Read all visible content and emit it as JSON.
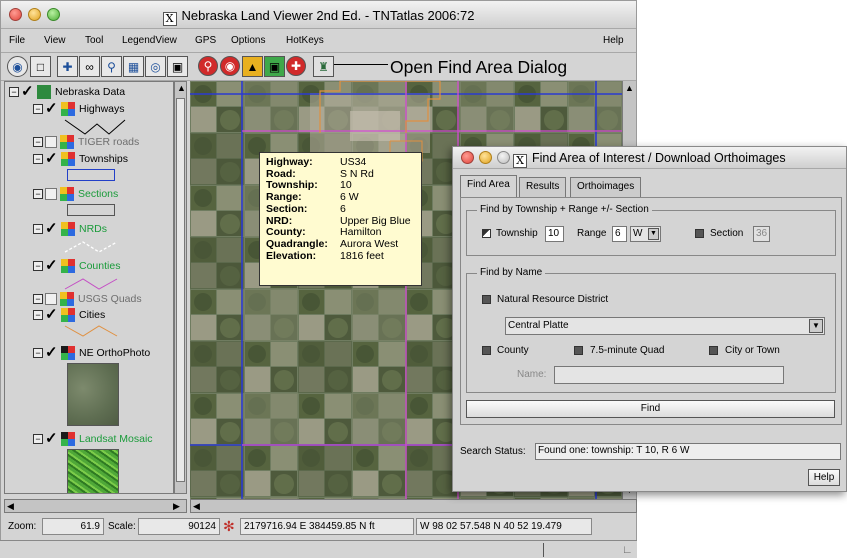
{
  "main_window": {
    "title": "Nebraska Land Viewer 2nd Ed. - TNTatlas 2006:72",
    "x_logo": "X"
  },
  "menu": {
    "items": [
      "File",
      "View",
      "Tool",
      "LegendView",
      "GPS",
      "Options",
      "HotKeys"
    ],
    "help": "Help"
  },
  "toolbar": {
    "icons": [
      "info-icon",
      "select-icon",
      "pan-icon",
      "measure-icon",
      "zoom-box-icon",
      "extents-icon",
      "target-icon",
      "camera-icon",
      "zoom-in-icon",
      "zoom-out-icon",
      "layout-icon",
      "home-zoom-icon",
      "find-area-icon"
    ]
  },
  "callout": {
    "text": "Open Find Area Dialog"
  },
  "legend": {
    "root": "Nebraska Data",
    "layers": [
      {
        "label": "Highways",
        "checked": true,
        "color": "#000000"
      },
      {
        "label": "TIGER roads",
        "checked": false,
        "color": "#6e6e6e"
      },
      {
        "label": "Townships",
        "checked": true,
        "color": "#000000"
      },
      {
        "label": "Sections",
        "checked": false,
        "color": "#1a9b3a"
      },
      {
        "label": "NRDs",
        "checked": true,
        "color": "#1a9b3a"
      },
      {
        "label": "Counties",
        "checked": true,
        "color": "#1a9b3a"
      },
      {
        "label": "USGS Quads",
        "checked": false,
        "color": "#6e6e6e"
      },
      {
        "label": "Cities",
        "checked": true,
        "color": "#000000"
      },
      {
        "label": "NE OrthoPhoto",
        "checked": true,
        "color": "#000000"
      },
      {
        "label": "Landsat Mosaic",
        "checked": true,
        "color": "#1a9b3a"
      }
    ]
  },
  "tooltip": {
    "rows": [
      {
        "key": "Highway:",
        "value": "US34"
      },
      {
        "key": "Road:",
        "value": "S N Rd"
      },
      {
        "key": "Township:",
        "value": "10"
      },
      {
        "key": "Range:",
        "value": "6 W"
      },
      {
        "key": "Section:",
        "value": "6"
      },
      {
        "key": "NRD:",
        "value": "Upper Big Blue"
      },
      {
        "key": "County:",
        "value": "Hamilton"
      },
      {
        "key": "Quadrangle:",
        "value": "Aurora West"
      },
      {
        "key": "Elevation:",
        "value": "1816 feet"
      }
    ]
  },
  "statusbar": {
    "zoom_label": "Zoom:",
    "zoom_value": "61.9",
    "scale_label": "Scale:",
    "scale_value": "90124",
    "coords_ft": "2179716.94 E  384459.85 N ft",
    "coords_latlon": "W 98 02 57.548  N 40 52 19.479"
  },
  "dialog": {
    "title": "Find Area of Interest / Download Orthoimages",
    "tabs": [
      "Find Area",
      "Results",
      "Orthoimages"
    ],
    "township_group": {
      "title": "Find by Township + Range +/- Section",
      "township_label": "Township",
      "township_value": "10",
      "range_label": "Range",
      "range_value": "6",
      "range_dir": "W",
      "section_label": "Section",
      "section_value": "36"
    },
    "name_group": {
      "title": "Find by Name",
      "nrd_label": "Natural Resource District",
      "nrd_selected": "Central Platte",
      "county_label": "County",
      "quad_label": "7.5-minute Quad",
      "city_label": "City or Town",
      "name_label": "Name:",
      "name_value": ""
    },
    "find_button": "Find",
    "search_status_label": "Search Status:",
    "search_status_value": "Found one: township: T 10, R 6 W",
    "help_button": "Help"
  }
}
